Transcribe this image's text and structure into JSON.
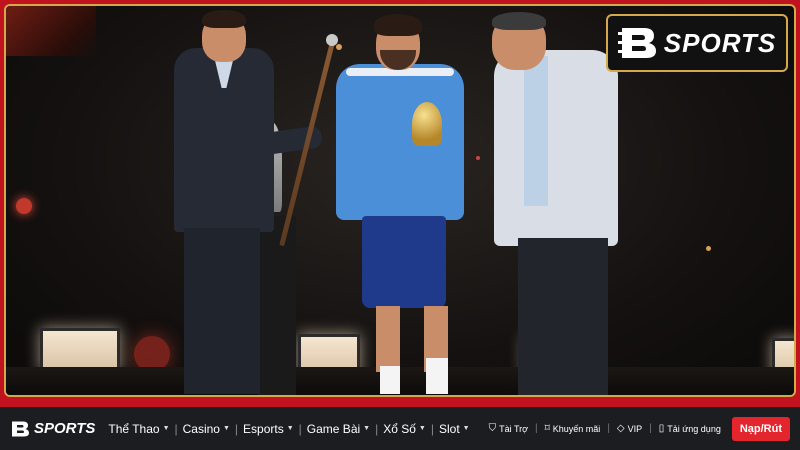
{
  "brand": {
    "logo_text": "SPORTS",
    "accent": "#c1121f",
    "gold": "#d4a94a"
  },
  "nav": {
    "logo_text": "SPORTS",
    "items": [
      {
        "label": "Thể Thao",
        "icon": "chevron-down-icon"
      },
      {
        "label": "Casino",
        "icon": "chevron-down-icon"
      },
      {
        "label": "Esports",
        "icon": "chevron-down-icon"
      },
      {
        "label": "Game Bài",
        "icon": "chevron-down-icon"
      },
      {
        "label": "Xổ Số",
        "icon": "chevron-down-icon"
      },
      {
        "label": "Slot",
        "icon": "chevron-down-icon"
      }
    ],
    "utilities": [
      {
        "label": "Tài Trợ",
        "icon": "shield-icon"
      },
      {
        "label": "Khuyến mãi",
        "icon": "tag-icon"
      },
      {
        "label": "VIP",
        "icon": "diamond-icon"
      },
      {
        "label": "Tải ứng dụng",
        "icon": "phone-icon"
      }
    ],
    "cta_label": "Nạp/Rút",
    "cta_color": "#e3262e"
  }
}
